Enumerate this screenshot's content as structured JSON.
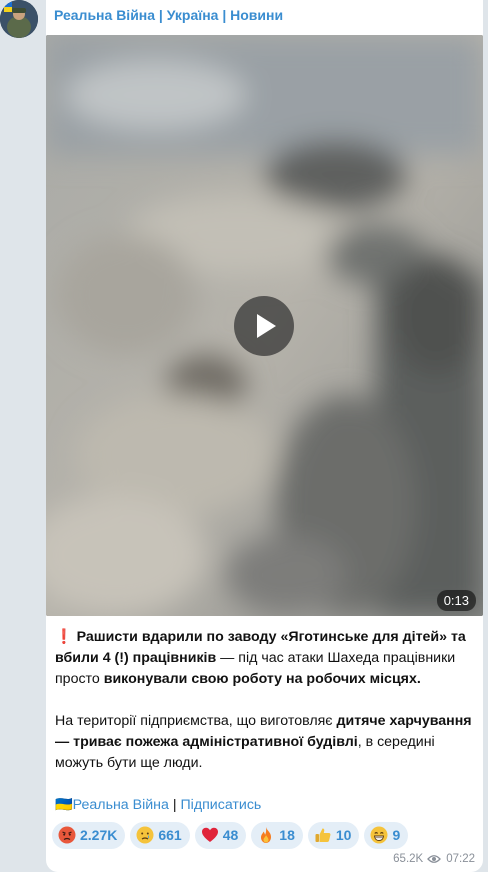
{
  "channel": {
    "name": "Реальна Війна | Україна | Новини"
  },
  "video": {
    "duration": "0:13"
  },
  "post": {
    "line1_icon": "❗️",
    "line1_bold": "Рашисти вдарили по заводу «Яготинське для дітей» та вбили 4 (!) працівників",
    "line1_rest": " — під час атаки Шахеда працівники просто ",
    "line1_bold2": "виконували свою роботу на робочих місцях.",
    "p2_start": "На території підприємства, що виготовляє ",
    "p2_bold1": "дитяче харчування — триває пожежа адміністративної будівлі",
    "p2_end": ", в середині можуть бути ще люди.",
    "footer_flag": "🇺🇦",
    "footer_link1": "Реальна Війна",
    "footer_sep": " | ",
    "footer_link2": "Підписатись"
  },
  "reactions": [
    {
      "emoji": "angry-face",
      "count": "2.27K",
      "color": "#e8573b"
    },
    {
      "emoji": "crying-face",
      "count": "661",
      "color": "#f5c33b"
    },
    {
      "emoji": "red-heart",
      "count": "48",
      "color": "#e0243b"
    },
    {
      "emoji": "fire",
      "count": "18",
      "color": "#f57c1f"
    },
    {
      "emoji": "thumbs-up",
      "count": "10",
      "color": "#f5c33b"
    },
    {
      "emoji": "grinning-face",
      "count": "9",
      "color": "#f5c33b"
    }
  ],
  "meta": {
    "views": "65.2K",
    "time": "07:22"
  }
}
